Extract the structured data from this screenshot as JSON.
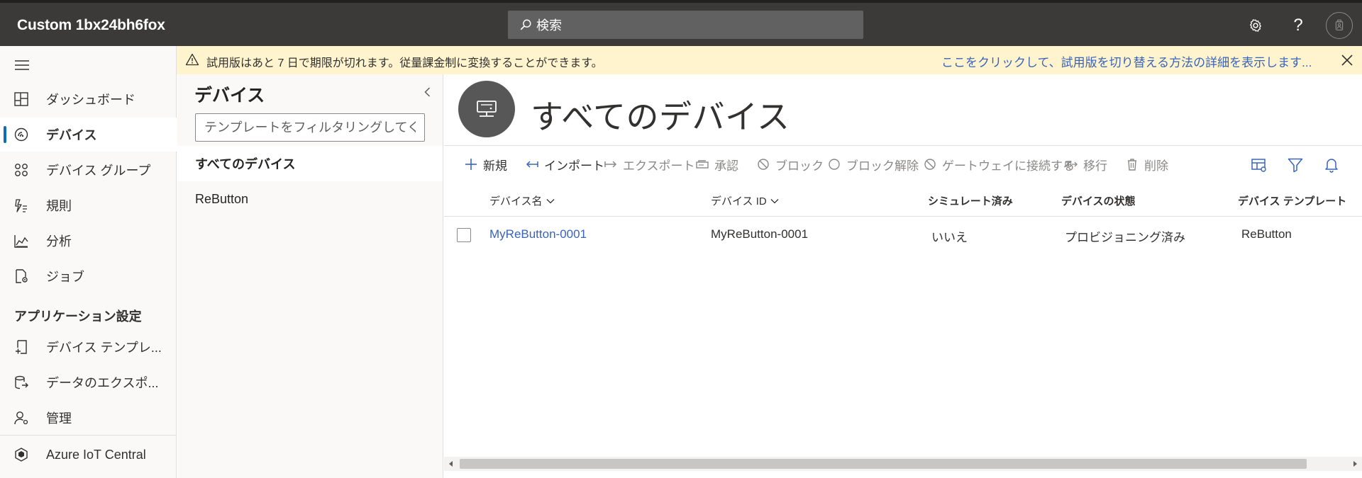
{
  "app": {
    "title": "Custom 1bx24bh6fox"
  },
  "topbar": {
    "search_placeholder": "検索",
    "settings_icon": "gear-icon",
    "help_label": "?",
    "avatar_icon": "avatar-icon"
  },
  "nav": {
    "items": [
      {
        "label": "ダッシュボード",
        "icon": "dashboard-icon"
      },
      {
        "label": "デバイス",
        "icon": "devices-icon",
        "active": true
      },
      {
        "label": "デバイス グループ",
        "icon": "device-groups-icon"
      },
      {
        "label": "規則",
        "icon": "rules-icon"
      },
      {
        "label": "分析",
        "icon": "analytics-icon"
      },
      {
        "label": "ジョブ",
        "icon": "jobs-icon"
      }
    ],
    "section_label": "アプリケーション設定",
    "settings_items": [
      {
        "label": "デバイス テンプレ...",
        "icon": "device-template-icon"
      },
      {
        "label": "データのエクスポ...",
        "icon": "data-export-icon"
      },
      {
        "label": "管理",
        "icon": "admin-icon"
      }
    ],
    "footer_label": "Azure IoT Central"
  },
  "banner": {
    "message": "試用版はあと 7 日で期限が切れます。従量課金制に変換することができます。",
    "link": "ここをクリックして、試用版を切り替える方法の詳細を表示します...",
    "background": "#fff4ce"
  },
  "subpanel": {
    "title": "デバイス",
    "filter_placeholder": "テンプレートをフィルタリングしてく",
    "items": [
      {
        "label": "すべてのデバイス",
        "selected": true
      },
      {
        "label": "ReButton",
        "selected": false
      }
    ]
  },
  "main": {
    "title": "すべてのデバイス",
    "toolbar": {
      "new": "新規",
      "import": "インポート",
      "export": "エクスポート",
      "approve": "承認",
      "block": "ブロック",
      "unblock": "ブロック解除",
      "attach_gateway": "ゲートウェイに接続する",
      "migrate": "移行",
      "delete": "削除"
    },
    "columns": {
      "device_name": "デバイス名",
      "device_id": "デバイス ID",
      "simulated": "シミュレート済み",
      "device_status": "デバイスの状態",
      "device_template": "デバイス テンプレート"
    },
    "rows": [
      {
        "device_name": "MyReButton-0001",
        "device_id": "MyReButton-0001",
        "simulated": "いいえ",
        "device_status": "プロビジョニング済み",
        "device_template": "ReButton"
      }
    ]
  },
  "colors": {
    "accent": "#0f6cbd",
    "link": "#3a63b8",
    "topbar": "#3b3a39"
  }
}
